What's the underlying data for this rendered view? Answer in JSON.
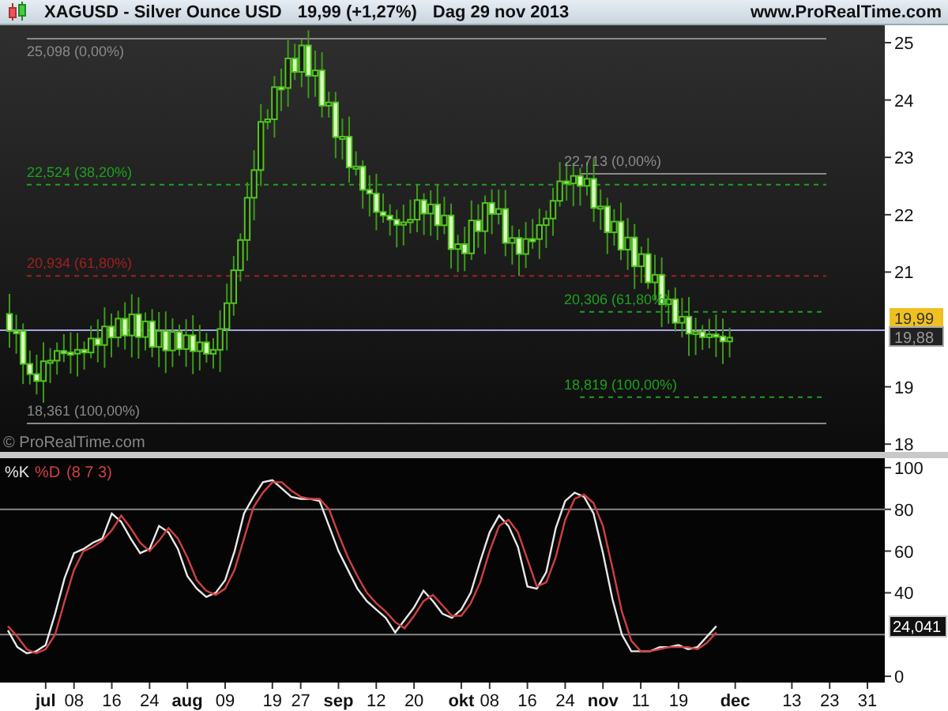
{
  "header": {
    "symbol": "XAGUSD - Silver Ounce USD",
    "quote": "19,99 (+1,27%)",
    "period": "Dag  29 nov 2013",
    "website": "www.ProRealTime.com"
  },
  "price_panel": {
    "y_ticks": [
      "25",
      "24",
      "23",
      "22",
      "21",
      "19",
      "18"
    ],
    "fibonacci": [
      {
        "label": "25,098 (0,00%)",
        "color": "#8a8a8a"
      },
      {
        "label": "22,524 (38,20%)",
        "color": "#1fa01f"
      },
      {
        "label": "20,934 (61,80%)",
        "color": "#a02020"
      },
      {
        "label": "18,361 (100,00%)",
        "color": "#8a8a8a"
      },
      {
        "label": "22,713 (0,00%)",
        "color": "#8a8a8a"
      },
      {
        "label": "20,306 (61,80%)",
        "color": "#1fa01f"
      },
      {
        "label": "18,819 (100,00%)",
        "color": "#1fa01f"
      }
    ],
    "last_price": "19,99",
    "cursor_price": "19,88",
    "copyright": "© ProRealTime.com"
  },
  "oscillator": {
    "d_params": "(8 7 3)",
    "value": "24,041",
    "chart_data": {
      "type": "line",
      "ylim": [
        -3,
        104.5
      ],
      "yticks": [
        0,
        40,
        60,
        80,
        100
      ],
      "categories": [
        null,
        null,
        null,
        null,
        "jul",
        null,
        null,
        "08",
        null,
        null,
        null,
        "16",
        null,
        null,
        null,
        "24",
        null,
        null,
        null,
        "aug",
        null,
        null,
        null,
        "09",
        null,
        null,
        null,
        null,
        "19",
        null,
        null,
        "27",
        null,
        null,
        null,
        "sep",
        null,
        null,
        null,
        "12",
        null,
        null,
        null,
        "20",
        null,
        null,
        null,
        null,
        "okt",
        null,
        null,
        "08",
        null,
        null,
        null,
        "16",
        null,
        null,
        null,
        "24",
        null,
        null,
        null,
        "nov",
        null,
        null,
        null,
        "11",
        null,
        null,
        null,
        "19",
        null,
        null,
        null,
        null,
        null,
        "dec",
        null,
        null,
        null,
        null,
        null,
        "13",
        null,
        null,
        null,
        "23",
        null,
        null,
        null,
        "31",
        null
      ],
      "series": [
        {
          "name": "%K",
          "color": "#e8e8e8",
          "values": [
            22,
            14,
            11,
            12,
            15,
            30,
            47,
            59,
            61,
            64,
            66,
            78,
            74,
            66,
            59,
            61,
            72,
            69,
            61,
            48,
            42,
            38,
            40,
            46,
            60,
            78,
            86,
            93,
            94,
            90,
            86,
            85,
            85,
            84,
            72,
            60,
            51,
            42,
            36,
            32,
            28,
            21,
            27,
            33,
            41,
            36,
            30,
            28,
            32,
            40,
            55,
            69,
            77,
            72,
            62,
            43,
            42,
            50,
            71,
            84,
            88,
            86,
            78,
            59,
            37,
            20,
            12,
            12,
            12,
            14,
            14,
            15,
            13,
            14,
            19,
            24,
            null,
            null,
            null,
            null,
            null,
            null,
            null,
            null,
            null,
            null,
            null,
            null,
            null,
            null,
            null,
            null,
            null
          ]
        },
        {
          "name": "%D",
          "color": "#d04040",
          "values": [
            24,
            19,
            13,
            11,
            13,
            20,
            36,
            51,
            60,
            62,
            65,
            70,
            77,
            71,
            64,
            60,
            65,
            71,
            66,
            57,
            46,
            41,
            39,
            42,
            51,
            66,
            81,
            88,
            93,
            93,
            89,
            86,
            85,
            85,
            80,
            68,
            57,
            48,
            40,
            35,
            31,
            26,
            23,
            29,
            36,
            39,
            34,
            29,
            29,
            35,
            45,
            60,
            72,
            75,
            69,
            56,
            43,
            45,
            57,
            75,
            85,
            87,
            83,
            72,
            52,
            31,
            17,
            12,
            12,
            13,
            14,
            14,
            14,
            13,
            16,
            21,
            null,
            null,
            null,
            null,
            null,
            null,
            null,
            null,
            null,
            null,
            null,
            null,
            null,
            null,
            null,
            null,
            null
          ]
        }
      ]
    }
  }
}
